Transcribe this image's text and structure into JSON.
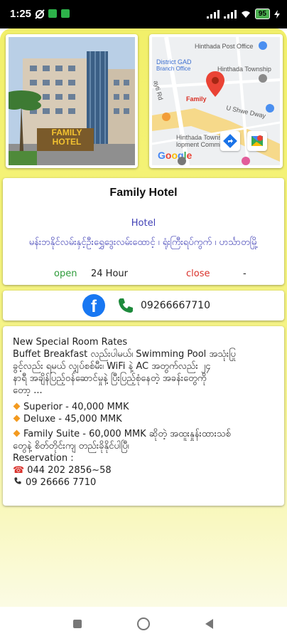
{
  "status_bar": {
    "time": "1:25",
    "battery": "95"
  },
  "hotel": {
    "name": "Family Hotel",
    "category": "Hotel",
    "address": "မန်းဘနိုင်လမ်းနှင့်ဦးရွှေဒွေးလမ်းထောင့် ၊ ရုံးကြီးရပ်ကွက် ၊ ဟင်္သာတမြို့",
    "open_label": "open",
    "open_value": "24 Hour",
    "close_label": "close",
    "close_value": "-",
    "phone": "09266667710",
    "photo_sign": "FAMILY HOTEL"
  },
  "map": {
    "labels": {
      "post_office": "Hinthada Post Office",
      "district": "District GAD",
      "branch": "Branch Office",
      "township": "Hinthada Township",
      "road": "ayti Rd",
      "pin": "Family",
      "street": "U Shwe Dway",
      "committee": "Hinthada Townsh",
      "committee2": "lopment Committe",
      "google": "Google"
    }
  },
  "description": {
    "lines": [
      "New Special Room Rates",
      "Buffet Breakfast လည်းပါမယ်၊ Swimming Pool အသုံးပြု",
      "ခွင့်လည်း ရမယ် လျှပ်စစ်မီး၊ WiFi နဲ့ AC အတွက်လည်း ၂၄",
      "နာရီ အချိန်ပြည့်ဝန်ဆောင်မှုနဲ့ ပြီးပြည့်စုံနေတဲ့ အခန်းတွေကို",
      "တော့ ..."
    ],
    "rates": [
      "Superior - 40,000 MMK",
      "Deluxe - 45,000 MMK",
      "Family Suite - 60,000 MMK ဆိုတဲ့ အထူးနှုန်းထားသစ်"
    ],
    "rate_cont": "တွေနဲ့ စိတ်တိုင်းကျ တည်းခိုနိုင်ပါပြီ၊",
    "reservation_label": "Reservation :",
    "tel1": "044 202 2856~58",
    "tel2": "09 26666 7710"
  },
  "colors": {
    "accent_yellow": "#f2f06a",
    "link_blue": "#3f3fb5",
    "open_green": "#2e9b3a",
    "close_red": "#d9302a",
    "facebook_blue": "#1877f2"
  }
}
